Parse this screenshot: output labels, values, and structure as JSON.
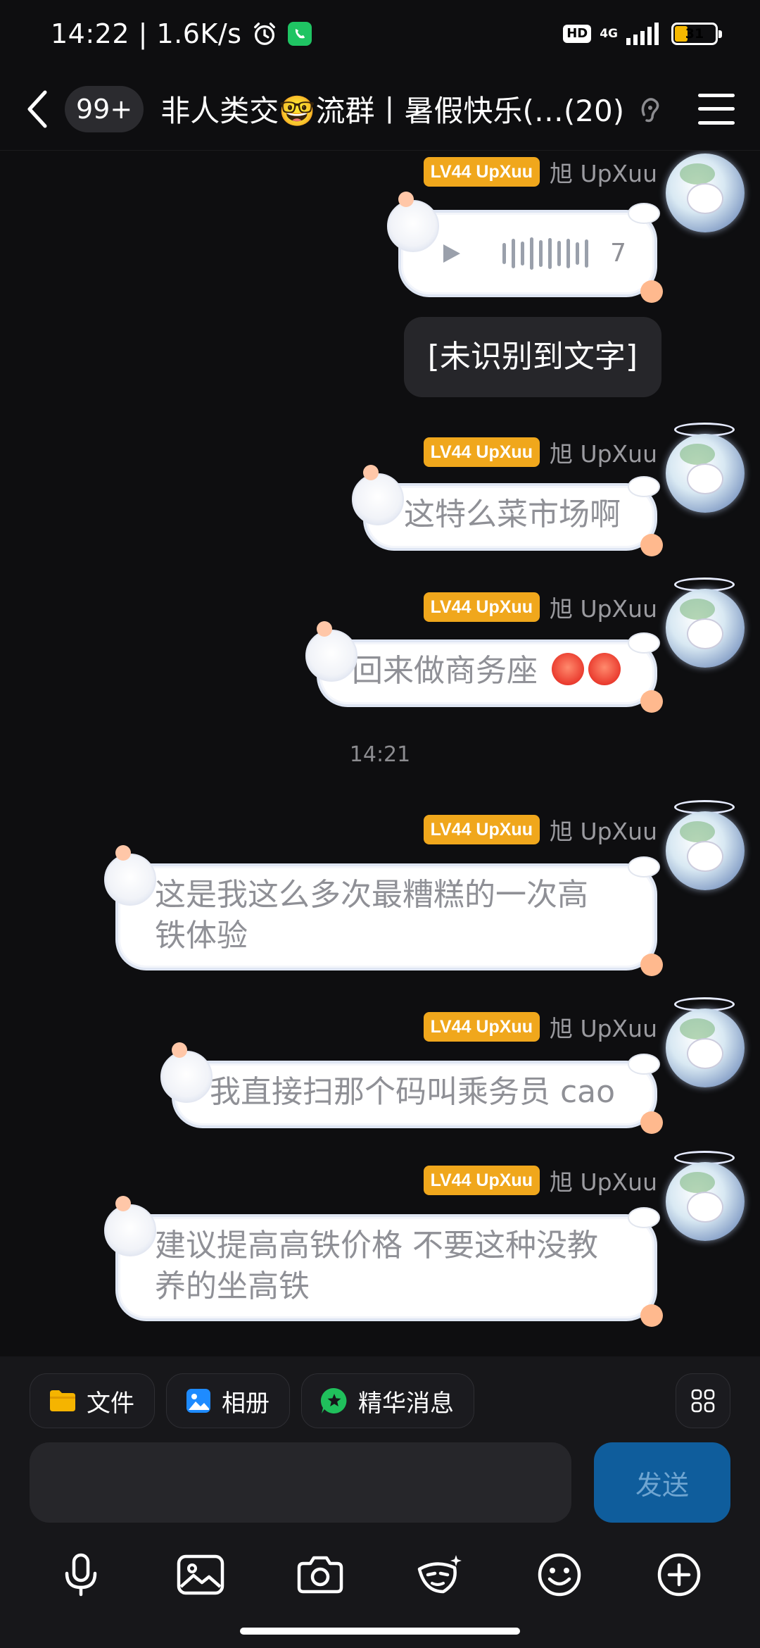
{
  "status_bar": {
    "time": "14:22",
    "speed": "1.6K/s",
    "hd": "HD",
    "network": "4G",
    "battery": "31"
  },
  "top_bar": {
    "unread": "99+",
    "title": "非人类交🤓流群丨暑假快乐(…(20)"
  },
  "messages": [
    {
      "type": "voice",
      "level": "LV44 UpXuu",
      "sender": "旭 UpXuu",
      "duration": "7"
    },
    {
      "type": "transcript",
      "text": "[未识别到文字]"
    },
    {
      "type": "text",
      "level": "LV44 UpXuu",
      "sender": "旭 UpXuu",
      "lines": [
        "这特么菜市场啊"
      ]
    },
    {
      "type": "text",
      "level": "LV44 UpXuu",
      "sender": "旭 UpXuu",
      "lines": [
        "回来做商务座 "
      ]
    },
    {
      "type": "time",
      "text": "14:21"
    },
    {
      "type": "text",
      "level": "LV44 UpXuu",
      "sender": "旭 UpXuu",
      "lines": [
        "这是我这么多次最糟糕的一次高",
        "铁体验"
      ]
    },
    {
      "type": "text",
      "level": "LV44 UpXuu",
      "sender": "旭 UpXuu",
      "lines": [
        "我直接扫那个码叫乘务员 cao"
      ]
    },
    {
      "type": "text",
      "level": "LV44 UpXuu",
      "sender": "旭 UpXuu",
      "lines": [
        "建议提高高铁价格 不要这种没教",
        "养的坐高铁"
      ]
    }
  ],
  "quick_actions": {
    "file": "文件",
    "album": "相册",
    "featured": "精华消息"
  },
  "input": {
    "value": "",
    "send_label": "发送"
  },
  "colors": {
    "background": "#0e0e10",
    "level_badge": "#f0a71c",
    "send_button": "#0f5d9c",
    "bubble_text": "#8f9096"
  }
}
